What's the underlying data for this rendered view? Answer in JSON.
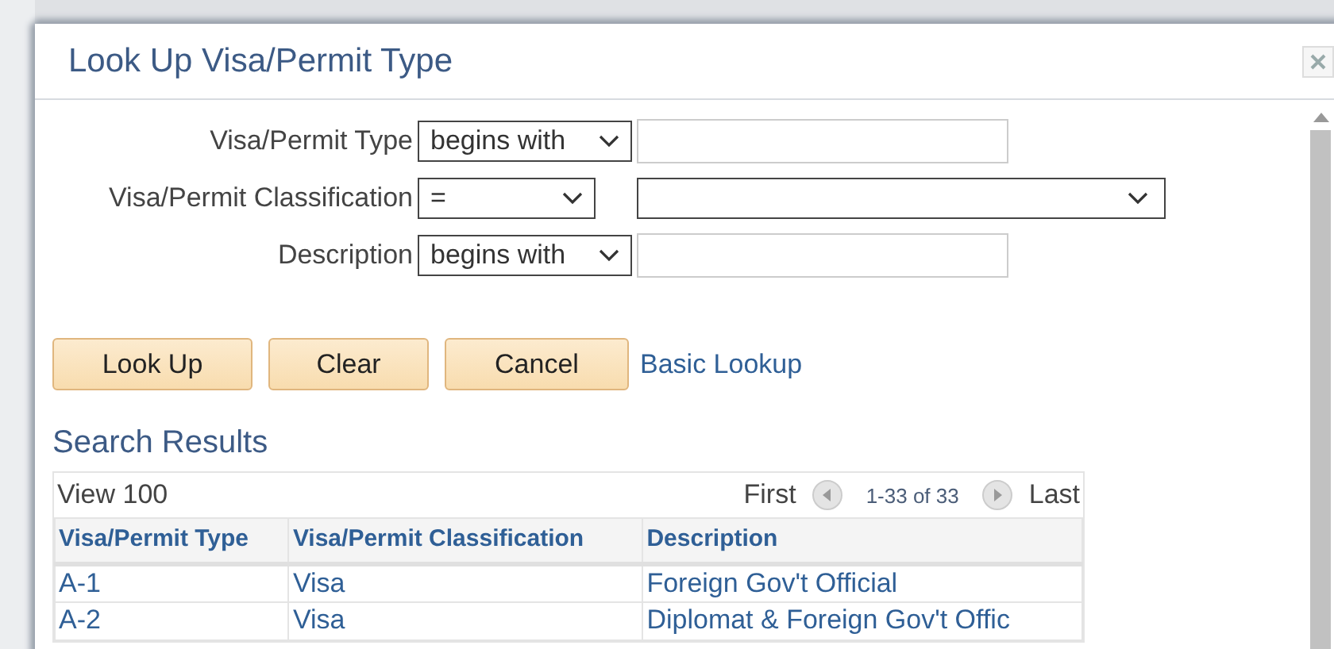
{
  "dialog": {
    "title": "Look Up Visa/Permit Type"
  },
  "criteria": [
    {
      "label": "Visa/Permit Type",
      "operator": "begins with",
      "kind": "text"
    },
    {
      "label": "Visa/Permit Classification",
      "operator": "=",
      "kind": "select"
    },
    {
      "label": "Description",
      "operator": "begins with",
      "kind": "text"
    }
  ],
  "buttons": [
    "Look Up",
    "Clear",
    "Cancel"
  ],
  "link": "Basic Lookup",
  "results": {
    "title": "Search Results",
    "view": "View 100",
    "first": "First",
    "range": "1-33 of 33",
    "last": "Last",
    "columns": [
      "Visa/Permit Type",
      "Visa/Permit Classification",
      "Description"
    ],
    "rows": [
      [
        "A-1",
        "Visa",
        "Foreign Gov't Official"
      ],
      [
        "A-2",
        "Visa",
        "Diplomat & Foreign Gov't Offic"
      ]
    ]
  }
}
